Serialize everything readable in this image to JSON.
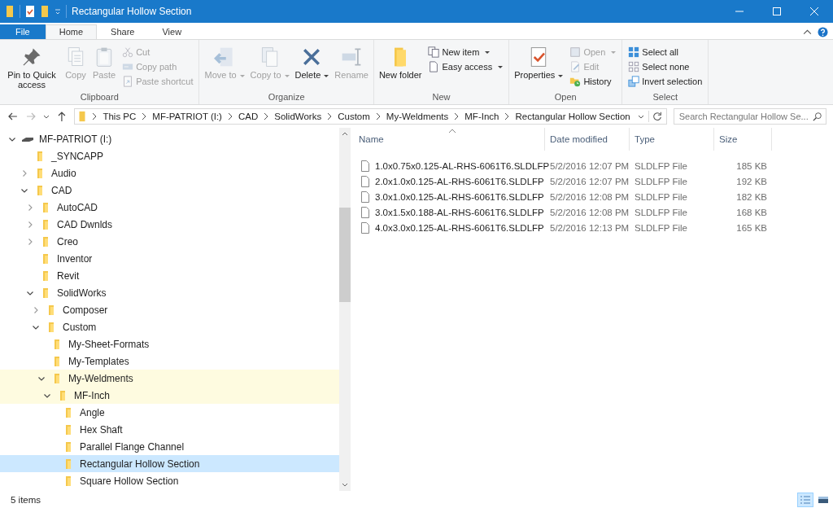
{
  "window": {
    "title": "Rectangular Hollow Section"
  },
  "tabs": [
    {
      "label": "File",
      "kind": "file",
      "selected": false
    },
    {
      "label": "Home",
      "kind": "tab",
      "selected": true
    },
    {
      "label": "Share",
      "kind": "tab",
      "selected": false
    },
    {
      "label": "View",
      "kind": "tab",
      "selected": false
    }
  ],
  "ribbon": [
    {
      "label": "Clipboard",
      "items": [
        {
          "label": "Pin to Quick access",
          "kind": "large",
          "disabled": false,
          "dropdown": false
        },
        {
          "label": "Copy",
          "kind": "large",
          "disabled": true,
          "dropdown": false
        },
        {
          "label": "Paste",
          "kind": "large",
          "disabled": true,
          "dropdown": false
        },
        {
          "label": "Cut",
          "kind": "small",
          "disabled": true,
          "dropdown": false
        },
        {
          "label": "Copy path",
          "kind": "small",
          "disabled": true,
          "dropdown": false
        },
        {
          "label": "Paste shortcut",
          "kind": "small",
          "disabled": true,
          "dropdown": false
        }
      ]
    },
    {
      "label": "Organize",
      "items": [
        {
          "label": "Move to",
          "kind": "large",
          "disabled": true,
          "dropdown": true
        },
        {
          "label": "Copy to",
          "kind": "large",
          "disabled": true,
          "dropdown": true
        },
        {
          "label": "Delete",
          "kind": "large",
          "disabled": false,
          "dropdown": true
        },
        {
          "label": "Rename",
          "kind": "large",
          "disabled": true,
          "dropdown": false
        }
      ]
    },
    {
      "label": "New",
      "items": [
        {
          "label": "New folder",
          "kind": "large",
          "disabled": false,
          "dropdown": false
        },
        {
          "label": "New item",
          "kind": "small",
          "disabled": false,
          "dropdown": true
        },
        {
          "label": "Easy access",
          "kind": "small",
          "disabled": false,
          "dropdown": true
        }
      ]
    },
    {
      "label": "Open",
      "items": [
        {
          "label": "Properties",
          "kind": "large",
          "disabled": false,
          "dropdown": true
        },
        {
          "label": "Open",
          "kind": "small",
          "disabled": true,
          "dropdown": true
        },
        {
          "label": "Edit",
          "kind": "small",
          "disabled": true,
          "dropdown": false
        },
        {
          "label": "History",
          "kind": "small",
          "disabled": false,
          "dropdown": false
        }
      ]
    },
    {
      "label": "Select",
      "items": [
        {
          "label": "Select all",
          "kind": "small",
          "disabled": false,
          "dropdown": false
        },
        {
          "label": "Select none",
          "kind": "small",
          "disabled": false,
          "dropdown": false
        },
        {
          "label": "Invert selection",
          "kind": "small",
          "disabled": false,
          "dropdown": false
        }
      ]
    }
  ],
  "address_bar": {
    "path": [
      "This PC",
      "MF-PATRIOT (I:)",
      "CAD",
      "SolidWorks",
      "Custom",
      "My-Weldments",
      "MF-Inch",
      "Rectangular Hollow Section"
    ],
    "search": {
      "placeholder": "Search Rectangular Hollow Se..."
    }
  },
  "navigation": {
    "tree": [
      {
        "label": "MF-PATRIOT (I:)",
        "kind": "drive",
        "expandable": true,
        "expanded": true,
        "selected": false,
        "highlighted": false,
        "children": [
          {
            "label": "_SYNCAPP",
            "kind": "folder",
            "expandable": false,
            "selected": false,
            "highlighted": false
          },
          {
            "label": "Audio",
            "kind": "folder",
            "expandable": true,
            "expanded": false,
            "selected": false,
            "highlighted": false
          },
          {
            "label": "CAD",
            "kind": "folder",
            "expandable": true,
            "expanded": true,
            "selected": false,
            "highlighted": false,
            "children": [
              {
                "label": "AutoCAD",
                "kind": "folder",
                "expandable": true,
                "expanded": false,
                "selected": false,
                "highlighted": false
              },
              {
                "label": "CAD Dwnlds",
                "kind": "folder",
                "expandable": true,
                "expanded": false,
                "selected": false,
                "highlighted": false
              },
              {
                "label": "Creo",
                "kind": "folder",
                "expandable": true,
                "expanded": false,
                "selected": false,
                "highlighted": false
              },
              {
                "label": "Inventor",
                "kind": "folder",
                "expandable": false,
                "selected": false,
                "highlighted": false
              },
              {
                "label": "Revit",
                "kind": "folder",
                "expandable": false,
                "selected": false,
                "highlighted": false
              },
              {
                "label": "SolidWorks",
                "kind": "folder",
                "expandable": true,
                "expanded": true,
                "selected": false,
                "highlighted": false,
                "children": [
                  {
                    "label": "Composer",
                    "kind": "folder",
                    "expandable": true,
                    "expanded": false,
                    "selected": false,
                    "highlighted": false
                  },
                  {
                    "label": "Custom",
                    "kind": "folder",
                    "expandable": true,
                    "expanded": true,
                    "selected": false,
                    "highlighted": false,
                    "children": [
                      {
                        "label": "My-Sheet-Formats",
                        "kind": "folder",
                        "expandable": false,
                        "selected": false,
                        "highlighted": false
                      },
                      {
                        "label": "My-Templates",
                        "kind": "folder",
                        "expandable": false,
                        "selected": false,
                        "highlighted": false
                      },
                      {
                        "label": "My-Weldments",
                        "kind": "folder",
                        "expandable": true,
                        "expanded": true,
                        "selected": false,
                        "highlighted": true,
                        "children": [
                          {
                            "label": "MF-Inch",
                            "kind": "folder",
                            "expandable": true,
                            "expanded": true,
                            "selected": false,
                            "highlighted": true,
                            "children": [
                              {
                                "label": "Angle",
                                "kind": "folder",
                                "expandable": false,
                                "selected": false,
                                "highlighted": false
                              },
                              {
                                "label": "Hex Shaft",
                                "kind": "folder",
                                "expandable": false,
                                "selected": false,
                                "highlighted": false
                              },
                              {
                                "label": "Parallel Flange Channel",
                                "kind": "folder",
                                "expandable": false,
                                "selected": false,
                                "highlighted": false
                              },
                              {
                                "label": "Rectangular Hollow Section",
                                "kind": "folder",
                                "expandable": false,
                                "selected": true,
                                "highlighted": false
                              },
                              {
                                "label": "Square Hollow Section",
                                "kind": "folder",
                                "expandable": false,
                                "selected": false,
                                "highlighted": false
                              }
                            ]
                          }
                        ]
                      }
                    ]
                  }
                ]
              }
            ]
          }
        ]
      }
    ]
  },
  "files": {
    "columns": [
      "Name",
      "Date modified",
      "Type",
      "Size"
    ],
    "rows": [
      [
        "1.0x0.75x0.125-AL-RHS-6061T6.SLDLFP",
        "5/2/2016 12:07 PM",
        "SLDLFP File",
        "185 KB"
      ],
      [
        "2.0x1.0x0.125-AL-RHS-6061T6.SLDLFP",
        "5/2/2016 12:07 PM",
        "SLDLFP File",
        "192 KB"
      ],
      [
        "3.0x1.0x0.125-AL-RHS-6061T6.SLDLFP",
        "5/2/2016 12:08 PM",
        "SLDLFP File",
        "182 KB"
      ],
      [
        "3.0x1.5x0.188-AL-RHS-6061T6.SLDLFP",
        "5/2/2016 12:08 PM",
        "SLDLFP File",
        "168 KB"
      ],
      [
        "4.0x3.0x0.125-AL-RHS-6061T6.SLDLFP",
        "5/2/2016 12:13 PM",
        "SLDLFP File",
        "165 KB"
      ]
    ]
  },
  "status_bar": {
    "text": "5 items",
    "views": [
      {
        "kind": "details",
        "selected": true
      },
      {
        "kind": "large-icons",
        "selected": false
      }
    ]
  }
}
